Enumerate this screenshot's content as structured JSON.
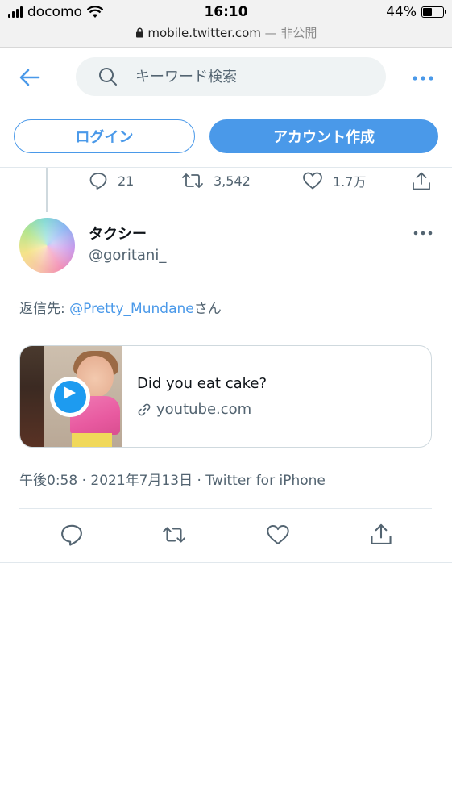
{
  "status_bar": {
    "carrier": "docomo",
    "time": "16:10",
    "battery": "44%",
    "battery_level": 0.44,
    "url": "mobile.twitter.com",
    "privacy": "— 非公開"
  },
  "nav": {
    "search_placeholder": "キーワード検索"
  },
  "auth": {
    "login_label": "ログイン",
    "signup_label": "アカウント作成"
  },
  "prev_tweet_actions": {
    "replies": "21",
    "retweets": "3,542",
    "likes": "1.7万"
  },
  "tweet": {
    "display_name": "タクシー",
    "handle": "@goritani_",
    "reply_prefix": "返信先: ",
    "reply_mention": "@Pretty_Mundane",
    "reply_suffix": "さん",
    "card": {
      "title": "Did you eat cake?",
      "domain": "youtube.com"
    },
    "timestamp": "午後0:58 · 2021年7月13日 · Twitter for iPhone"
  },
  "colors": {
    "accent": "#4a99e9",
    "secondary_text": "#536471"
  }
}
